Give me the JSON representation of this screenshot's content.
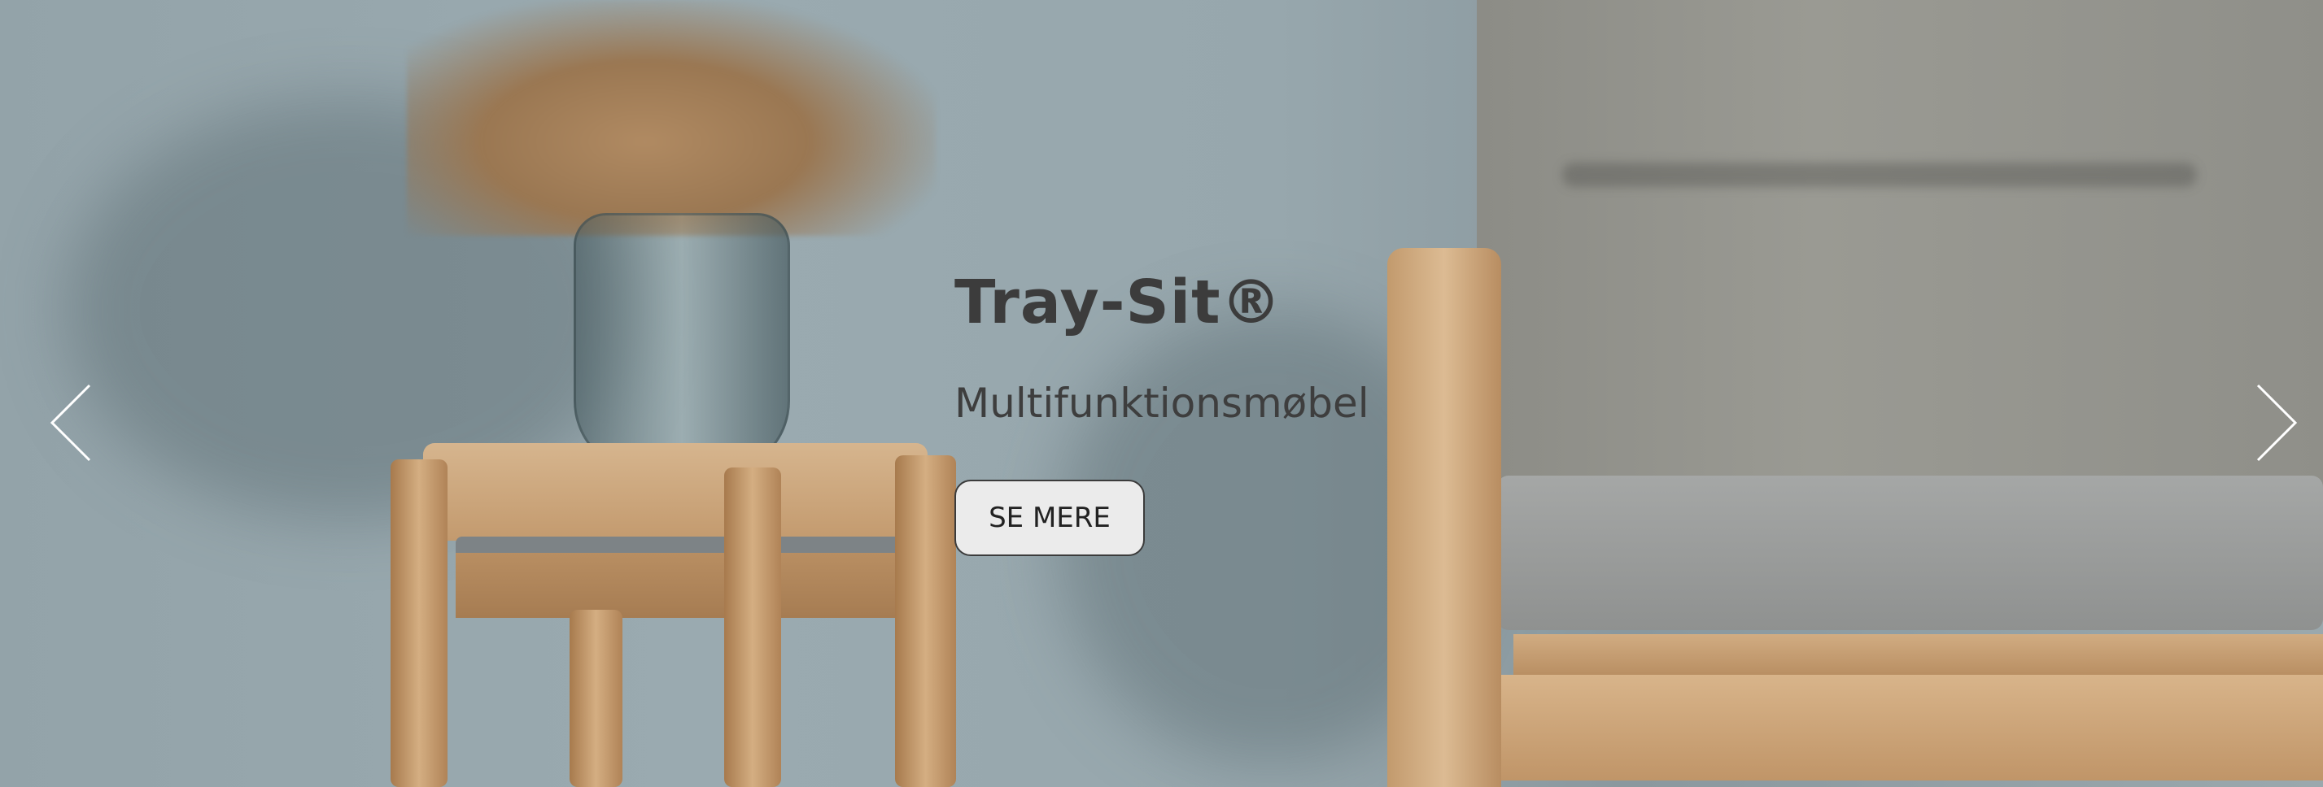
{
  "hero": {
    "title": "Tray-Sit®",
    "subtitle": "Multifunktionsmøbel",
    "cta_label": "SE MERE"
  },
  "nav": {
    "prev_icon": "chevron-left-icon",
    "next_icon": "chevron-right-icon"
  },
  "colors": {
    "wall": "#93a3a9",
    "text": "#3c3c3c",
    "button_bg": "#ebebeb",
    "arrow": "#ffffff"
  }
}
